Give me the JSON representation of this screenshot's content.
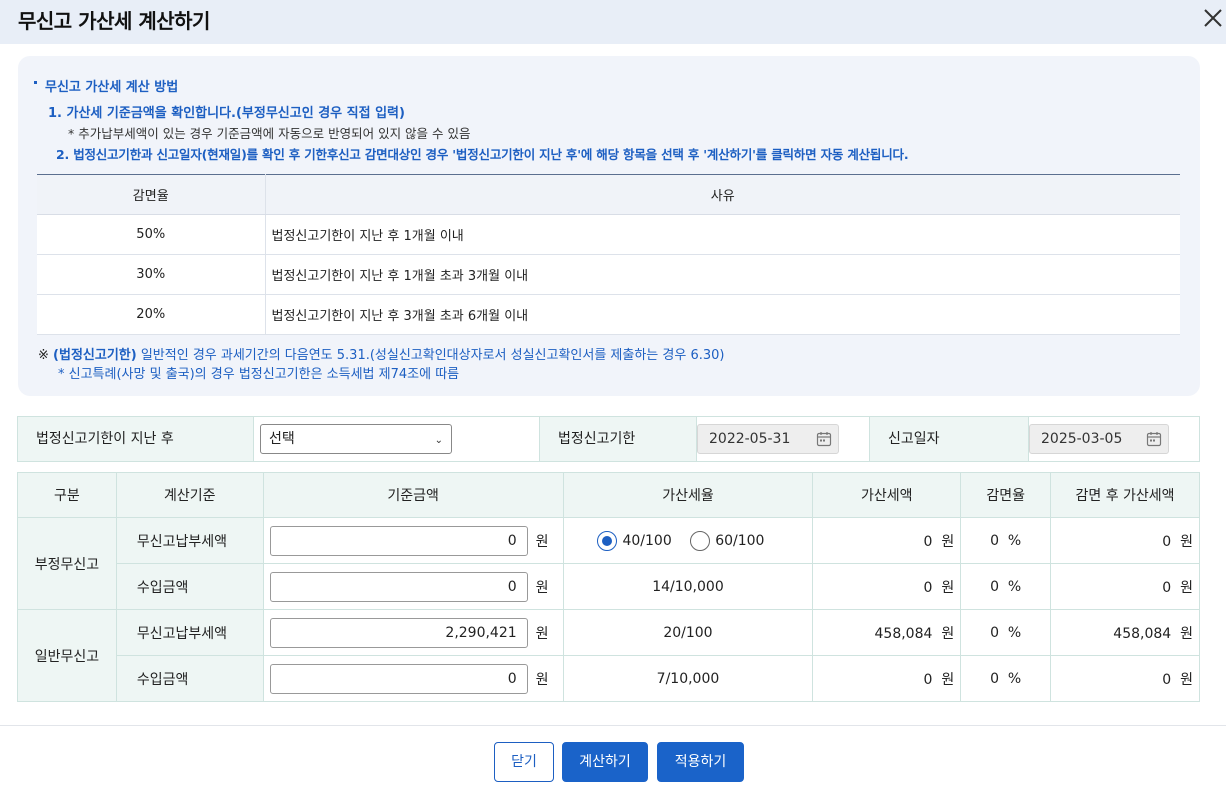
{
  "dialog": {
    "title": "무신고 가산세 계산하기"
  },
  "guide": {
    "heading": "무신고 가산세 계산 방법",
    "step1": "1. 가산세 기준금액을 확인합니다.(부정무신고인 경우 직접 입력)",
    "step1_note": "* 추가납부세액이 있는 경우 기준금액에 자동으로 반영되어 있지 않을 수 있음",
    "step2": "2. 법정신고기한과 신고일자(현재일)를 확인 후 기한후신고 감면대상인 경우 '법정신고기한이 지난 후'에 해당 항목을 선택 후 '계산하기'를 클릭하면 자동 계산됩니다.",
    "table": {
      "headers": [
        "감면율",
        "사유"
      ],
      "rows": [
        {
          "rate": "50%",
          "reason": "법정신고기한이 지난 후 1개월 이내"
        },
        {
          "rate": "30%",
          "reason": "법정신고기한이 지난 후 1개월 초과 3개월 이내"
        },
        {
          "rate": "20%",
          "reason": "법정신고기한이 지난 후 3개월 초과 6개월 이내"
        }
      ]
    },
    "note_mark": "※",
    "note_bold": "(법정신고기한)",
    "note_text": "일반적인 경우 과세기간의 다음연도 5.31.(성실신고확인대상자로서 성실신고확인서를 제출하는 경우 6.30)",
    "note2": "* 신고특례(사망 및 출국)의 경우 법정신고기한은 소득세법 제74조에 따름"
  },
  "date_bar": {
    "after_label": "법정신고기한이 지난 후",
    "select_value": "선택",
    "deadline_label": "법정신고기한",
    "deadline_value": "2022-05-31",
    "report_label": "신고일자",
    "report_value": "2025-03-05"
  },
  "calc": {
    "headers": [
      "구분",
      "계산기준",
      "기준금액",
      "가산세율",
      "가산세액",
      "감면율",
      "감면 후 가산세액"
    ],
    "won": "원",
    "percent": "%",
    "groups": {
      "fraud": "부정무신고",
      "general": "일반무신고"
    },
    "rows": [
      {
        "basis": "무신고납부세액",
        "amount": "0",
        "rate": "",
        "tax": "0",
        "reduction": "0",
        "after": "0"
      },
      {
        "basis": "수입금액",
        "amount": "0",
        "rate": "14/10,000",
        "tax": "0",
        "reduction": "0",
        "after": "0"
      },
      {
        "basis": "무신고납부세액",
        "amount": "2,290,421",
        "rate": "20/100",
        "tax": "458,084",
        "reduction": "0",
        "after": "458,084"
      },
      {
        "basis": "수입금액",
        "amount": "0",
        "rate": "7/10,000",
        "tax": "0",
        "reduction": "0",
        "after": "0"
      }
    ],
    "radio_options": [
      "40/100",
      "60/100"
    ],
    "radio_selected": "40/100"
  },
  "buttons": {
    "close": "닫기",
    "calculate": "계산하기",
    "apply": "적용하기"
  },
  "colors": {
    "accent": "#1d5fc2",
    "title_bar": "#e8eef7",
    "guide_bg": "#f1f4fa",
    "table_header_bg": "#eef6f4"
  }
}
